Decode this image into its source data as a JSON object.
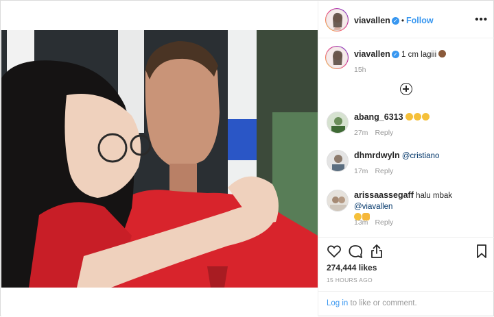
{
  "post": {
    "author": "viavallen",
    "follow_label": "Follow",
    "separator": "•",
    "caption_text": "1 cm lagiii",
    "caption_time": "15h",
    "likes": "274,444 likes",
    "timestamp": "15 HOURS AGO"
  },
  "comments": [
    {
      "user": "abang_6313",
      "text": "",
      "time": "27m",
      "reply": "Reply",
      "emoji": [
        "#f5c03a",
        "#f5c03a",
        "#f5c03a"
      ]
    },
    {
      "user": "dhmrdwyln",
      "text": "",
      "mention": "@cristiano",
      "time": "17m",
      "reply": "Reply"
    },
    {
      "user": "arissaassegaff",
      "text": "halu mbak",
      "mention": "@viavallen",
      "time": "13m",
      "reply": "Reply",
      "emoji": [
        "#f5c03a",
        "#f5b73a"
      ]
    }
  ],
  "footer": {
    "login_link": "Log in",
    "login_rest": " to like or comment."
  },
  "icons": [
    "more-options-icon",
    "load-more-icon",
    "heart-icon",
    "comment-icon",
    "share-icon",
    "bookmark-icon",
    "verified-icon"
  ],
  "colors": {
    "accent": "#3897f0",
    "verified": "#3897f0",
    "muted": "#999999",
    "text": "#262626"
  }
}
